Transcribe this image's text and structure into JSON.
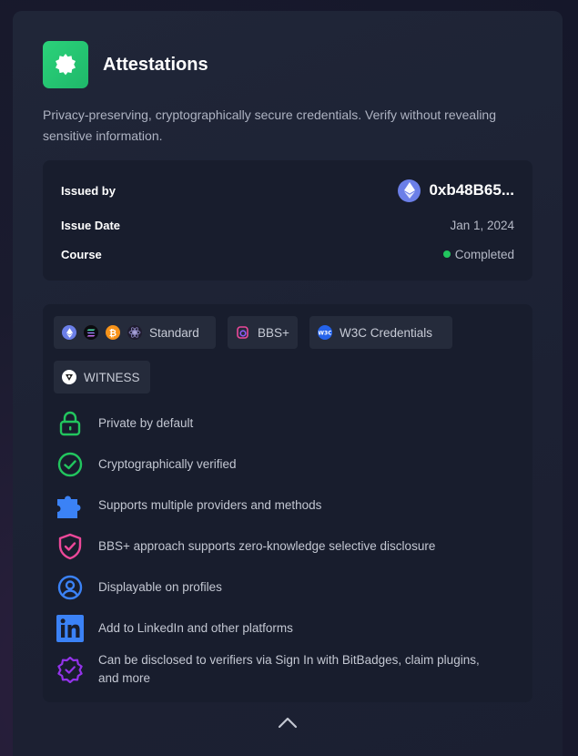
{
  "header": {
    "title": "Attestations",
    "logo_icon": "badge-seal-icon"
  },
  "description": "Privacy-preserving, cryptographically secure credentials. Verify without revealing sensitive information.",
  "info": {
    "issued_by_label": "Issued by",
    "issued_by_value": "0xb48B65...",
    "issue_date_label": "Issue Date",
    "issue_date_value": "Jan 1, 2024",
    "course_label": "Course",
    "course_value": "Completed",
    "status_color": "#22c55e"
  },
  "chips": {
    "standard": "Standard",
    "bbs": "BBS+",
    "w3c": "W3C Credentials",
    "witness": "WITNESS"
  },
  "features": [
    {
      "icon": "lock-icon",
      "text": "Private by default"
    },
    {
      "icon": "check-circle-icon",
      "text": "Cryptographically verified"
    },
    {
      "icon": "puzzle-icon",
      "text": "Supports multiple providers and methods"
    },
    {
      "icon": "shield-check-icon",
      "text": "BBS+ approach supports zero-knowledge selective disclosure"
    },
    {
      "icon": "user-circle-icon",
      "text": "Displayable on profiles"
    },
    {
      "icon": "linkedin-icon",
      "text": "Add to LinkedIn and other platforms"
    },
    {
      "icon": "verified-badge-icon",
      "text": "Can be disclosed to verifiers via Sign In with BitBadges, claim plugins, and more"
    }
  ],
  "colors": {
    "accent_green": "#22c55e",
    "eth": "#6b7fe8",
    "linkedin": "#3b82f6",
    "pink": "#ec4899",
    "purple": "#9333ea"
  }
}
